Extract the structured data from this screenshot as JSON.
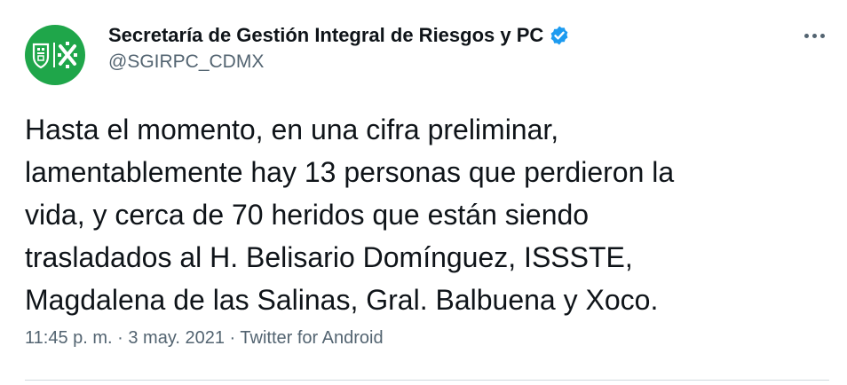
{
  "author": {
    "display_name": "Secretaría de Gestión Integral de Riesgos y PC",
    "handle": "@SGIRPC_CDMX",
    "verified_icon": "verified-badge-icon",
    "avatar_color": "#1fa64a"
  },
  "tweet": {
    "text": "Hasta el momento, en una cifra preliminar,\nlamentablemente hay 13 personas que perdieron la\nvida, y cerca de 70 heridos que están siendo\ntrasladados al H. Belisario Domínguez, ISSSTE,\nMagdalena de las Salinas, Gral. Balbuena y Xoco."
  },
  "meta": {
    "time": "11:45 p. m.",
    "separator": "·",
    "date": "3 may. 2021",
    "source": "Twitter for Android"
  },
  "colors": {
    "verified": "#1d9bf0",
    "secondary_text": "#536471"
  }
}
